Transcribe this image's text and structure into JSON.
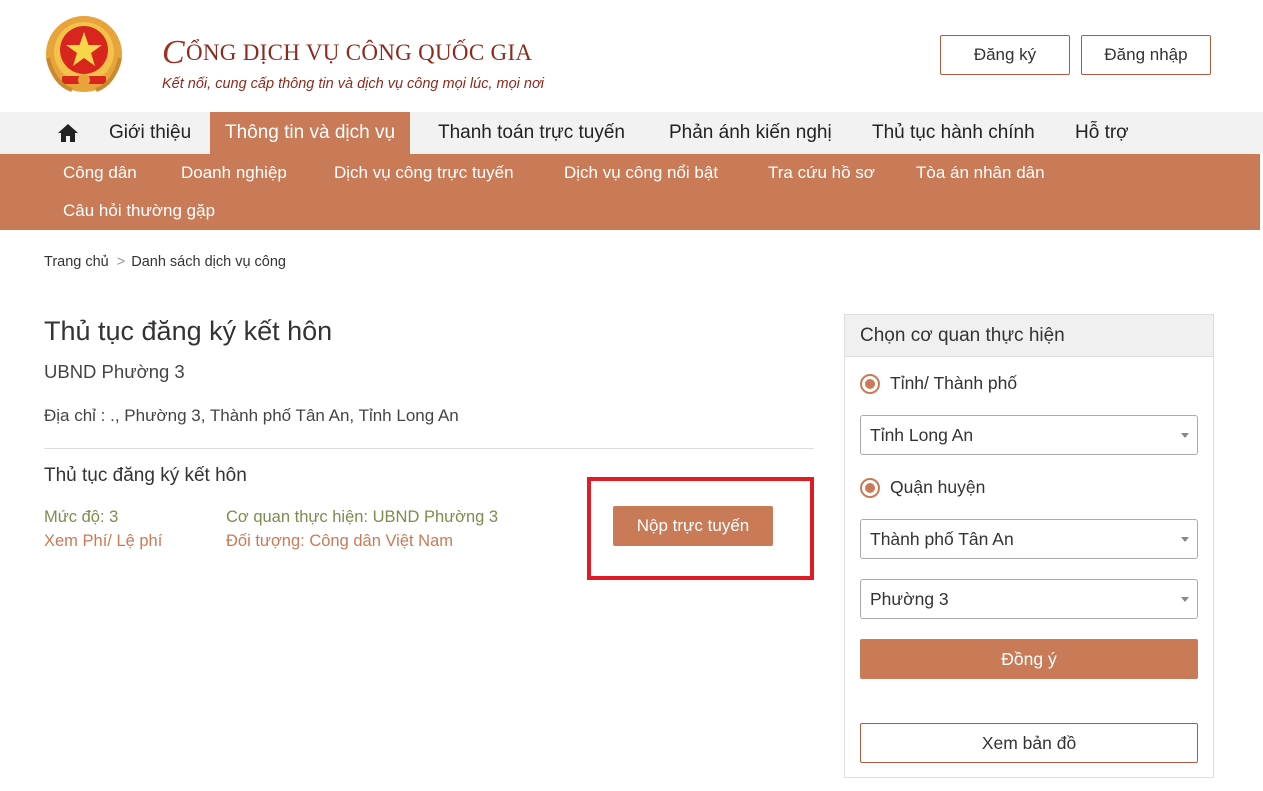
{
  "header": {
    "title_initial": "C",
    "title_rest": "ỔNG DỊCH VỤ CÔNG QUỐC GIA",
    "tagline": "Kết nối, cung cấp thông tin và dịch vụ công mọi lúc, mọi nơi",
    "register_label": "Đăng ký",
    "login_label": "Đăng nhập"
  },
  "main_nav": {
    "home_icon": "home-icon",
    "items": [
      {
        "label": "Giới thiệu",
        "active": false
      },
      {
        "label": "Thông tin và dịch vụ",
        "active": true
      },
      {
        "label": "Thanh toán trực tuyến",
        "active": false
      },
      {
        "label": "Phản ánh kiến nghị",
        "active": false
      },
      {
        "label": "Thủ tục hành chính",
        "active": false
      },
      {
        "label": "Hỗ trợ",
        "active": false
      }
    ]
  },
  "sub_nav": {
    "items": [
      "Công dân",
      "Doanh nghiệp",
      "Dịch vụ công trực tuyến",
      "Dịch vụ công nổi bật",
      "Tra cứu hồ sơ",
      "Tòa án nhân dân",
      "Câu hỏi thường gặp"
    ]
  },
  "breadcrumb": {
    "home": "Trang chủ",
    "separator": ">",
    "current": "Danh sách dịch vụ công"
  },
  "content": {
    "title": "Thủ tục đăng ký kết hôn",
    "agency": "UBND Phường 3",
    "address": "Địa chỉ : ., Phường 3, Thành phố Tân An, Tỉnh Long An",
    "procedure": {
      "name": "Thủ tục đăng ký kết hôn",
      "level": "Mức độ: 3",
      "fee_link": "Xem Phí/ Lệ phí",
      "agency": "Cơ quan thực hiện: UBND Phường 3",
      "subject": "Đối tượng: Công dân Việt Nam",
      "submit_label": "Nộp trực tuyến"
    }
  },
  "sidebar": {
    "heading": "Chọn cơ quan thực hiện",
    "radio_province": "Tỉnh/ Thành phố",
    "province_value": "Tỉnh Long An",
    "radio_district": "Quận huyện",
    "district_value": "Thành phố Tân An",
    "ward_value": "Phường 3",
    "agree_label": "Đồng ý",
    "map_label": "Xem bản đồ"
  },
  "colors": {
    "accent": "#c97a56",
    "brand_red": "#8b2b1f",
    "highlight": "#e01b24",
    "meta_green": "#7a8c4e"
  }
}
